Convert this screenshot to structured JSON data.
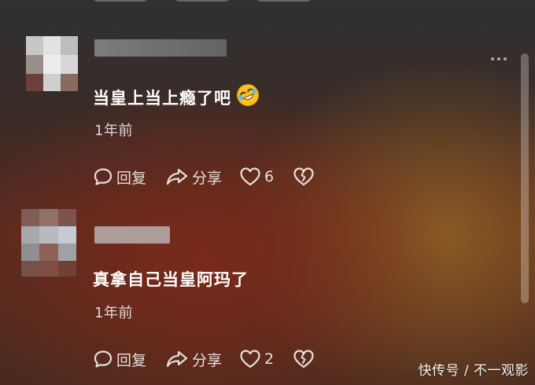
{
  "comments": [
    {
      "text": "当皇上当上瘾了吧",
      "emoji": "rolling-on-floor-laughing-emoji",
      "time": "1年前",
      "reply_label": "回复",
      "share_label": "分享",
      "like_count": "6"
    },
    {
      "text": "真拿自己当皇阿玛了",
      "time": "1年前",
      "reply_label": "回复",
      "share_label": "分享",
      "like_count": "2"
    }
  ],
  "watermark": "快传号 / 不一观影",
  "colors": {
    "text": "#ffffff",
    "secondary_text": "rgba(255,255,255,0.82)",
    "emoji_face": "#f7c21f"
  }
}
